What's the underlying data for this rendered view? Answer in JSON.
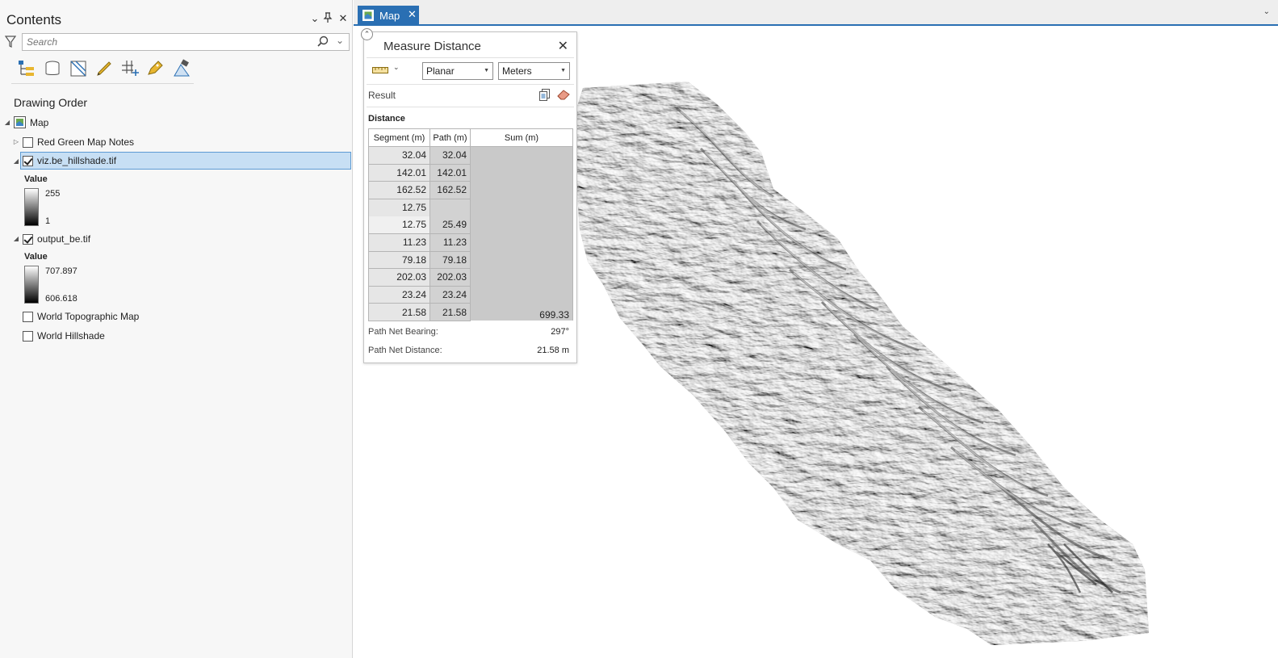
{
  "contents": {
    "title": "Contents",
    "search_placeholder": "Search",
    "section_title": "Drawing Order",
    "tools": [
      "list-by-drawing-order-icon",
      "list-by-source-icon",
      "list-by-selection-icon",
      "list-by-editing-icon",
      "list-by-snapping-icon",
      "list-by-labeling-icon",
      "list-by-perspective-imagery-icon"
    ],
    "map_item": "Map",
    "layers": [
      {
        "name": "Red Green Map Notes",
        "checked": false
      },
      {
        "name": "viz.be_hillshade.tif",
        "checked": true,
        "selected": true,
        "legend_title": "Value",
        "max": "255",
        "min": "1"
      },
      {
        "name": "output_be.tif",
        "checked": true,
        "legend_title": "Value",
        "max": "707.897",
        "min": "606.618"
      },
      {
        "name": "World Topographic Map",
        "checked": false
      },
      {
        "name": "World Hillshade",
        "checked": false
      }
    ]
  },
  "tabs": [
    {
      "label": "Map",
      "active": true
    }
  ],
  "measure": {
    "title": "Measure Distance",
    "mode": "Planar",
    "units": "Meters",
    "result_label": "Result",
    "distance_label": "Distance",
    "columns": [
      "Segment (m)",
      "Path (m)",
      "Sum (m)"
    ],
    "rows": [
      {
        "segment": "32.04",
        "path": "32.04"
      },
      {
        "segment": "142.01",
        "path": "142.01"
      },
      {
        "segment": "162.52",
        "path": "162.52"
      },
      {
        "segment": "12.75",
        "path": ""
      },
      {
        "segment": "12.75",
        "path": "25.49"
      },
      {
        "segment": "11.23",
        "path": "11.23"
      },
      {
        "segment": "79.18",
        "path": "79.18"
      },
      {
        "segment": "202.03",
        "path": "202.03"
      },
      {
        "segment": "23.24",
        "path": "23.24"
      },
      {
        "segment": "21.58",
        "path": "21.58"
      }
    ],
    "sum": "699.33",
    "bearing_label": "Path Net Bearing:",
    "bearing_value": "297°",
    "net_distance_label": "Path Net Distance:",
    "net_distance_value": "21.58 m"
  },
  "colors": {
    "accent": "#2a6fb3",
    "selection": "#c7dff4",
    "pane": "#f7f7f7"
  }
}
